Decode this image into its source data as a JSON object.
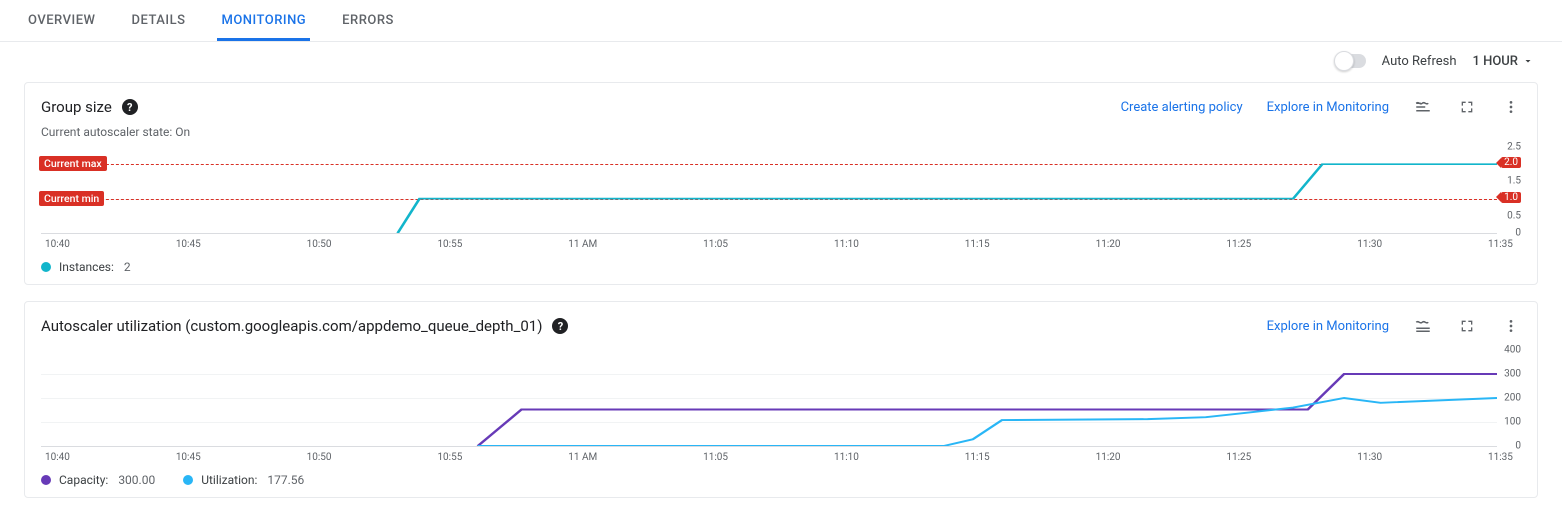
{
  "tabs": [
    {
      "label": "OVERVIEW",
      "active": false
    },
    {
      "label": "DETAILS",
      "active": false
    },
    {
      "label": "MONITORING",
      "active": true
    },
    {
      "label": "ERRORS",
      "active": false
    }
  ],
  "toolbar": {
    "auto_refresh_label": "Auto Refresh",
    "time_range": "1 HOUR"
  },
  "card1": {
    "title": "Group size",
    "subtext": "Current autoscaler state: On",
    "link_alert": "Create alerting policy",
    "link_explore": "Explore in Monitoring",
    "badge_max": "Current max",
    "badge_min": "Current min",
    "marker_max": "2.0",
    "marker_min": "1.0",
    "legend_label": "Instances:",
    "legend_value": "2"
  },
  "card2": {
    "title": "Autoscaler utilization (custom.googleapis.com/appdemo_queue_depth_01)",
    "link_explore": "Explore in Monitoring",
    "legend1_label": "Capacity:",
    "legend1_value": "300.00",
    "legend2_label": "Utilization:",
    "legend2_value": "177.56"
  },
  "x_ticks": [
    "10:40",
    "10:45",
    "10:50",
    "10:55",
    "11 AM",
    "11:05",
    "11:10",
    "11:15",
    "11:20",
    "11:25",
    "11:30",
    "11:35"
  ],
  "y_ticks_1": [
    "2.5",
    "2.0",
    "1.5",
    "1.0",
    "0.5",
    "0"
  ],
  "y_ticks_2": [
    "400",
    "300",
    "200",
    "100",
    "0"
  ],
  "chart_data": [
    {
      "type": "line",
      "title": "Group size",
      "ylabel": "",
      "xlabel": "",
      "ylim": [
        0,
        2.5
      ],
      "x": [
        "10:40",
        "10:45",
        "10:50",
        "10:55",
        "11 AM",
        "11:05",
        "11:10",
        "11:15",
        "11:20",
        "11:25",
        "11:30",
        "11:35"
      ],
      "series": [
        {
          "name": "Instances",
          "color": "#12b5cb",
          "values": [
            null,
            null,
            null,
            1,
            1,
            1,
            1,
            1,
            1,
            1,
            2,
            2
          ]
        }
      ],
      "reference_lines": [
        {
          "name": "Current max",
          "value": 2.0,
          "color": "#d93025"
        },
        {
          "name": "Current min",
          "value": 1.0,
          "color": "#d93025"
        }
      ]
    },
    {
      "type": "line",
      "title": "Autoscaler utilization (custom.googleapis.com/appdemo_queue_depth_01)",
      "ylabel": "",
      "xlabel": "",
      "ylim": [
        0,
        400
      ],
      "x": [
        "10:40",
        "10:45",
        "10:50",
        "10:55",
        "11 AM",
        "11:05",
        "11:10",
        "11:15",
        "11:20",
        "11:25",
        "11:30",
        "11:35"
      ],
      "series": [
        {
          "name": "Capacity",
          "color": "#673ab7",
          "values": [
            null,
            null,
            null,
            0,
            150,
            150,
            150,
            150,
            150,
            150,
            300,
            300
          ]
        },
        {
          "name": "Utilization",
          "color": "#12b5cb",
          "values": [
            null,
            null,
            null,
            0,
            0,
            0,
            0,
            30,
            110,
            120,
            160,
            200
          ]
        }
      ]
    }
  ]
}
